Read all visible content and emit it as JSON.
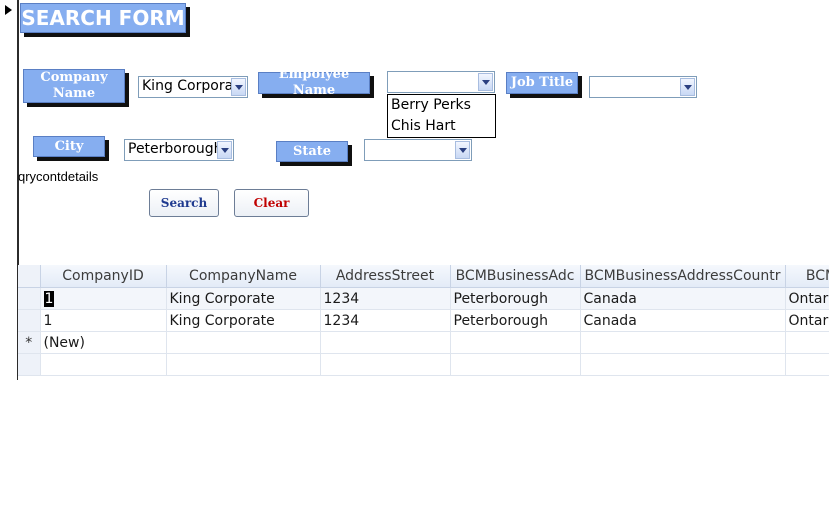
{
  "form": {
    "title": "SEARCH FORM",
    "query_name": "qrycontdetails"
  },
  "fields": {
    "company_label": "Company Name",
    "company_value": "King Corporat",
    "employee_label": "Empolyee Name",
    "employee_value": "",
    "employee_options": [
      "Berry Perks",
      "Chis Hart"
    ],
    "jobtitle_label": "Job Title",
    "jobtitle_value": "",
    "city_label": "City",
    "city_value": "Peterborough",
    "state_label": "State",
    "state_value": ""
  },
  "buttons": {
    "search_label": "Search",
    "clear_label": "Clear"
  },
  "grid": {
    "columns": [
      "CompanyID",
      "CompanyName",
      "AddressStreet",
      "BCMBusinessAdc",
      "BCMBusinessAddressCountr",
      "BCM"
    ],
    "rows": [
      [
        "1",
        "King Corporate",
        "1234",
        "Peterborough",
        "Canada",
        "Ontari"
      ],
      [
        "1",
        "King Corporate",
        "1234",
        "Peterborough",
        "Canada",
        "Ontari"
      ]
    ],
    "new_row_marker": "*",
    "new_row_label": "(New)"
  },
  "colors": {
    "label_bg": "#86aef0",
    "search_text": "#1f3a8f",
    "clear_text": "#c00000"
  }
}
